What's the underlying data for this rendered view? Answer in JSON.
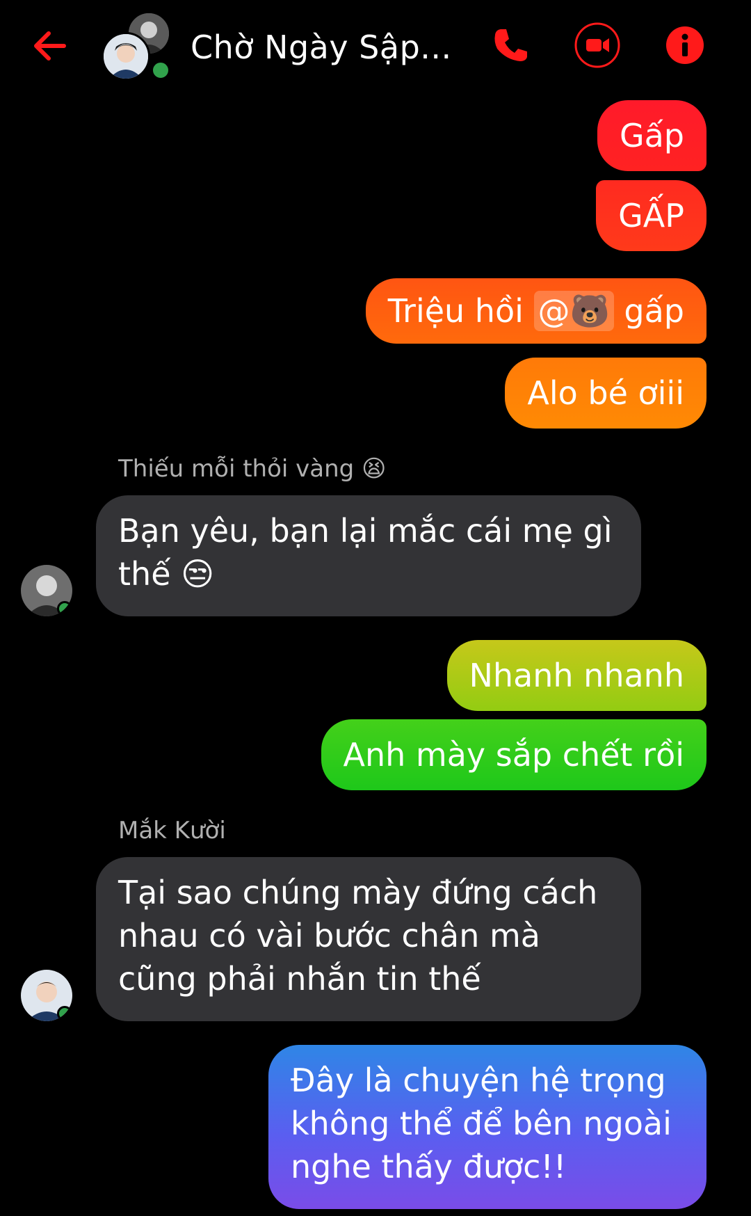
{
  "header": {
    "title": "Chờ Ngày Sập...",
    "icons": {
      "back": "arrow-left-icon",
      "call": "phone-icon",
      "video": "video-camera-icon",
      "info": "info-icon"
    }
  },
  "colors": {
    "accent": "#ff1a1a",
    "incoming_bubble": "#333336",
    "online": "#31a24c",
    "background": "#000000"
  },
  "messages": [
    {
      "dir": "out",
      "text": "Gấp"
    },
    {
      "dir": "out",
      "text": "GẤP"
    },
    {
      "dir": "out",
      "text_before": "Triệu hồi ",
      "mention": "@🐻",
      "text_after": " gấp"
    },
    {
      "dir": "out",
      "text": "Alo bé ơiii"
    },
    {
      "dir": "in",
      "sender": "Thiếu mỗi thỏi vàng 😫",
      "text": "Bạn yêu, bạn lại mắc cái mẹ gì thế 😒"
    },
    {
      "dir": "out",
      "text": "Nhanh nhanh"
    },
    {
      "dir": "out",
      "text": "Anh mày sắp chết rồi"
    },
    {
      "dir": "in",
      "sender": "Mắk Kười",
      "text": "Tại sao chúng mày đứng cách nhau có vài bước chân mà cũng phải nhắn tin thế"
    },
    {
      "dir": "out",
      "text": "Đây là chuyện hệ trọng không thể để bên ngoài nghe thấy được!!"
    }
  ]
}
